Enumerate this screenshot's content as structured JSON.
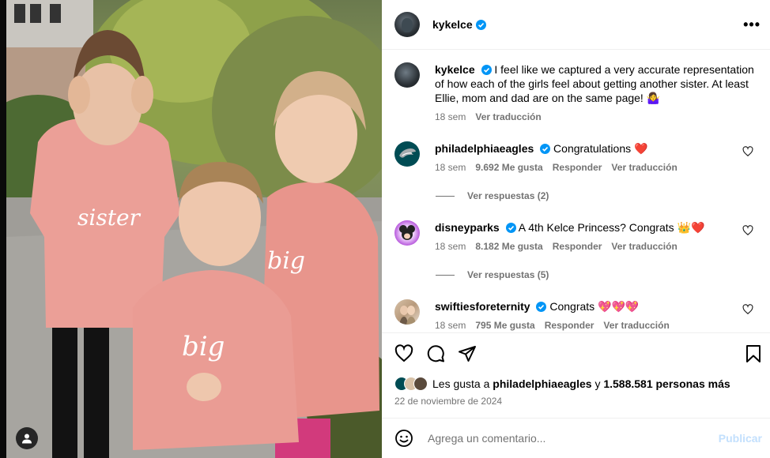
{
  "post": {
    "author": "kykelce",
    "more_icon": "more-horizontal-icon",
    "image_alt_icon": "tagged-user-icon"
  },
  "caption": {
    "username": "kykelce",
    "text": "I feel like we captured a very accurate representation of how each of the girls feel about getting another sister. At least Ellie, mom and dad are on the same page! 🤷‍♀️",
    "time": "18 sem",
    "translate": "Ver traducción"
  },
  "comments": [
    {
      "username": "philadelphiaeagles",
      "text": "Congratulations ❤️",
      "time": "18 sem",
      "likes": "9.692 Me gusta",
      "reply": "Responder",
      "translate": "Ver traducción",
      "replies": "Ver respuestas (2)"
    },
    {
      "username": "disneyparks",
      "text": "A 4th Kelce Princess? Congrats 👑❤️",
      "time": "18 sem",
      "likes": "8.182 Me gusta",
      "reply": "Responder",
      "translate": "Ver traducción",
      "replies": "Ver respuestas (5)"
    },
    {
      "username": "swiftiesforeternity",
      "text": "Congrats 💖💖💖",
      "time": "18 sem",
      "likes": "795 Me gusta",
      "reply": "Responder",
      "translate": "Ver traducción"
    }
  ],
  "likes": {
    "prefix": "Les gusta a",
    "user": "philadelphiaeagles",
    "conj": "y",
    "count": "1.588.581 personas más"
  },
  "date": "22 de noviembre de 2024",
  "add_comment": {
    "placeholder": "Agrega un comentario...",
    "publish": "Publicar"
  },
  "colors": {
    "verified": "#0095f6",
    "heart_red": "#ed4956",
    "publish_disabled": "#c3e0fd"
  }
}
